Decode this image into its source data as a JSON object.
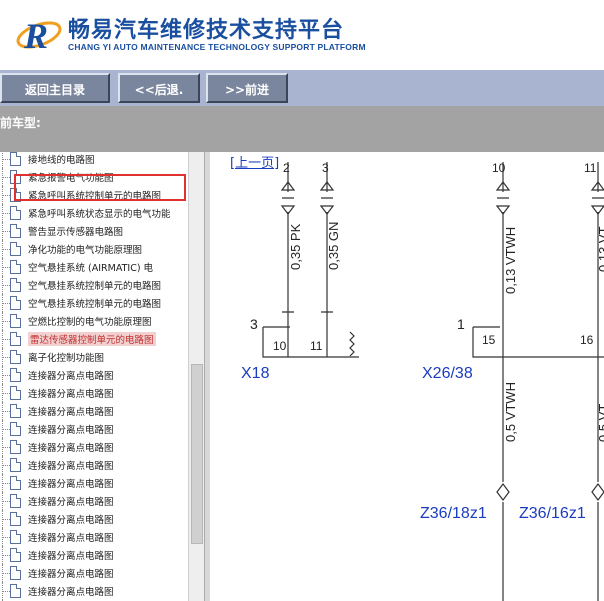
{
  "header": {
    "title_cn": "畅易汽车维修技术支持平台",
    "title_en": "CHANG YI AUTO MAINTENANCE TECHNOLOGY SUPPORT PLATFORM",
    "logo_icon": "R-logo-icon"
  },
  "toolbar": {
    "home_label": "返回主目录",
    "back_label": "<<后退.",
    "forward_label": ">>前进"
  },
  "model": {
    "label": "前车型:"
  },
  "tree": {
    "items": [
      {
        "label": "接地线的电路图"
      },
      {
        "label": "紧急报警电气功能图"
      },
      {
        "label": "紧急呼叫系统控制单元的电路图"
      },
      {
        "label": "紧急呼叫系统状态显示的电气功能"
      },
      {
        "label": "警告显示传感器电路图"
      },
      {
        "label": "净化功能的电气功能原理图"
      },
      {
        "label": "空气悬挂系统 (AIRMATIC) 电"
      },
      {
        "label": "空气悬挂系统控制单元的电路图"
      },
      {
        "label": "空气悬挂系统控制单元的电路图"
      },
      {
        "label": "空燃比控制的电气功能原理图"
      },
      {
        "label": "雷达传感器控制单元的电路图"
      },
      {
        "label": "离子化控制功能图"
      },
      {
        "label": "连接器分离点电路图"
      },
      {
        "label": "连接器分离点电路图"
      },
      {
        "label": "连接器分离点电路图"
      },
      {
        "label": "连接器分离点电路图"
      },
      {
        "label": "连接器分离点电路图"
      },
      {
        "label": "连接器分离点电路图"
      },
      {
        "label": "连接器分离点电路图"
      },
      {
        "label": "连接器分离点电路图"
      },
      {
        "label": "连接器分离点电路图"
      },
      {
        "label": "连接器分离点电路图"
      },
      {
        "label": "连接器分离点电路图"
      },
      {
        "label": "连接器分离点电路图"
      },
      {
        "label": "连接器分离点电路图"
      },
      {
        "label": "连接器分离点电路图"
      }
    ],
    "selected_index": 10
  },
  "diagram": {
    "prev_link": "[上一页]",
    "top_numbers": [
      "2",
      "3",
      "10",
      "11"
    ],
    "wires": [
      "0,35 PK",
      "0,35 GN",
      "0,13 VTWH",
      "0,13 VT",
      "0,5 VTWH",
      "0,5 VT"
    ],
    "connectors": [
      "X18",
      "X26/38"
    ],
    "connector_pin_labels": [
      "3",
      "1"
    ],
    "pins": [
      "10",
      "11",
      "15",
      "16"
    ],
    "splices": [
      "Z36/18z1",
      "Z36/16z1"
    ]
  }
}
